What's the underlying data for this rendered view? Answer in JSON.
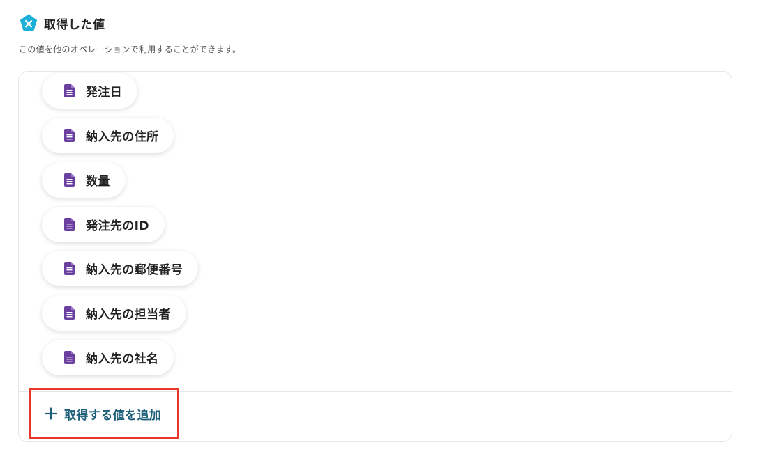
{
  "section": {
    "title": "取得した値",
    "description": "この値を他のオペレーションで利用することができます。",
    "icon": "yoom-logo-icon",
    "accent_color": "#1bb0d8"
  },
  "fields": [
    {
      "label": "発注日",
      "icon": "form-document-icon"
    },
    {
      "label": "納入先の住所",
      "icon": "form-document-icon"
    },
    {
      "label": "数量",
      "icon": "form-document-icon"
    },
    {
      "label": "発注先のID",
      "icon": "form-document-icon"
    },
    {
      "label": "納入先の郵便番号",
      "icon": "form-document-icon"
    },
    {
      "label": "納入先の担当者",
      "icon": "form-document-icon"
    },
    {
      "label": "納入先の社名",
      "icon": "form-document-icon"
    }
  ],
  "icon_color": "#6b3fa0",
  "add_button": {
    "label": "取得する値を追加",
    "icon": "plus-icon",
    "text_color": "#1d5f78",
    "highlight_color": "#e8362a"
  }
}
